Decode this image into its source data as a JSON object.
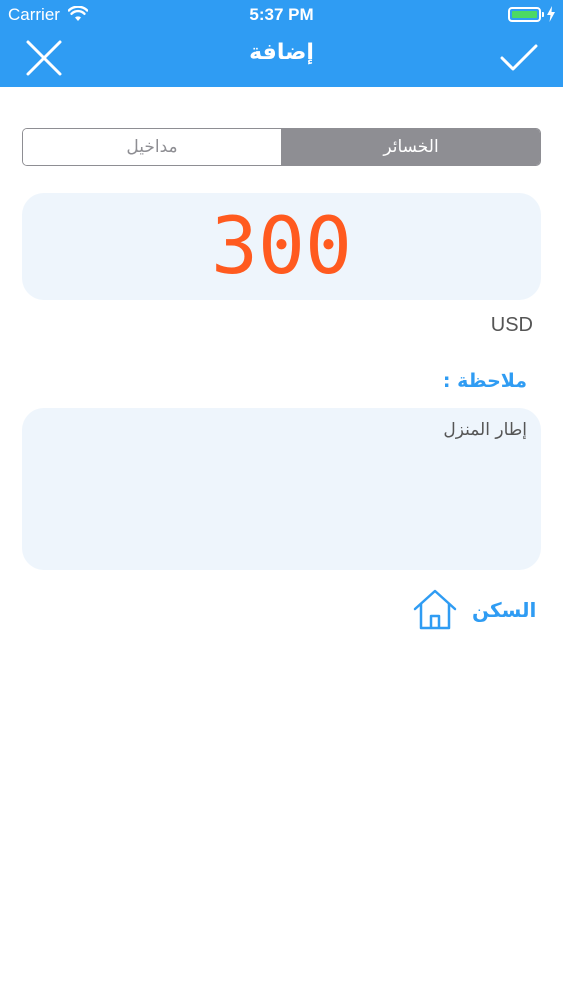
{
  "status_bar": {
    "carrier": "Carrier",
    "time": "5:37 PM",
    "icons": [
      "wifi-icon",
      "battery-icon",
      "charging-bolt-icon"
    ]
  },
  "header": {
    "title": "إضافة",
    "close_icon": "close-icon",
    "confirm_icon": "checkmark-icon",
    "background_color": "#2f9cf3"
  },
  "segmented_control": {
    "options": [
      "مداخيل",
      "الخسائر"
    ],
    "selected": "الخسائر"
  },
  "amount": {
    "value": "300",
    "currency": "USD",
    "color": "#ff5a1f"
  },
  "note": {
    "label": "ملاحظة :",
    "value": "إطار المنزل"
  },
  "category": {
    "label": "السكن",
    "icon": "house-icon",
    "color": "#2f9cf3"
  }
}
